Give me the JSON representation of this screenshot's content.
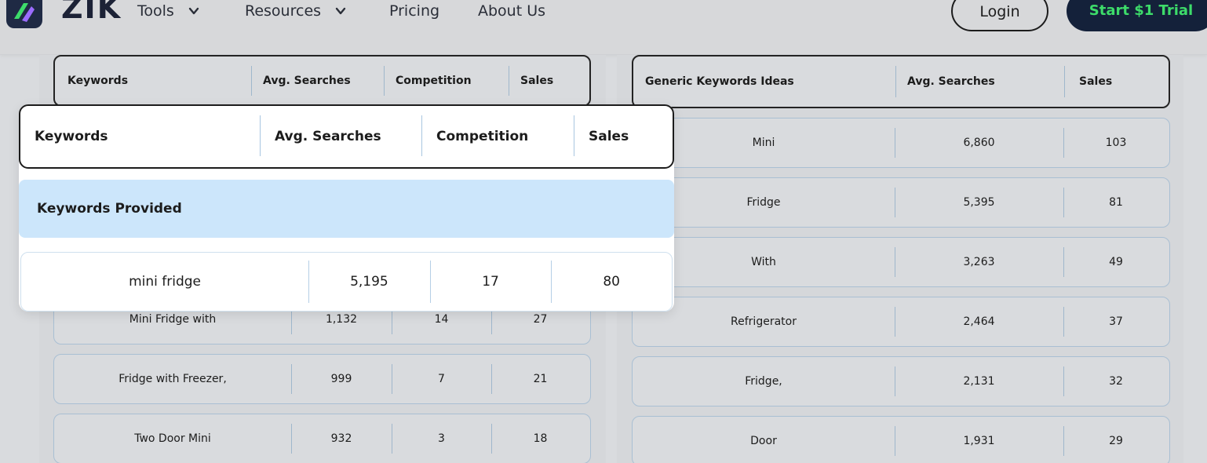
{
  "nav": {
    "brand": "ZIK",
    "tools": "Tools",
    "resources": "Resources",
    "pricing": "Pricing",
    "about": "About Us",
    "login": "Login",
    "trial": "Start $1 Trial"
  },
  "left_table": {
    "headers": [
      "Keywords",
      "Avg. Searches",
      "Competition",
      "Sales"
    ],
    "rows": [
      [
        "Mini Fridge with",
        "1,132",
        "14",
        "27"
      ],
      [
        "Fridge with Freezer,",
        "999",
        "7",
        "21"
      ],
      [
        "Two Door Mini",
        "932",
        "3",
        "18"
      ]
    ]
  },
  "right_table": {
    "headers": [
      "Generic Keywords Ideas",
      "Avg. Searches",
      "Sales"
    ],
    "rows": [
      [
        "Mini",
        "6,860",
        "103"
      ],
      [
        "Fridge",
        "5,395",
        "81"
      ],
      [
        "With",
        "3,263",
        "49"
      ],
      [
        "Refrigerator",
        "2,464",
        "37"
      ],
      [
        "Fridge,",
        "2,131",
        "32"
      ],
      [
        "Door",
        "1,931",
        "29"
      ]
    ]
  },
  "overlay": {
    "headers": [
      "Keywords",
      "Avg. Searches",
      "Competition",
      "Sales"
    ],
    "section": "Keywords Provided",
    "row": [
      "mini fridge",
      "5,195",
      "17",
      "80"
    ]
  },
  "colors": {
    "trial_bg": "#14213a",
    "trial_text": "#3ddc6a",
    "section_band": "#cce6fb",
    "row_border": "#a9bfd3"
  }
}
